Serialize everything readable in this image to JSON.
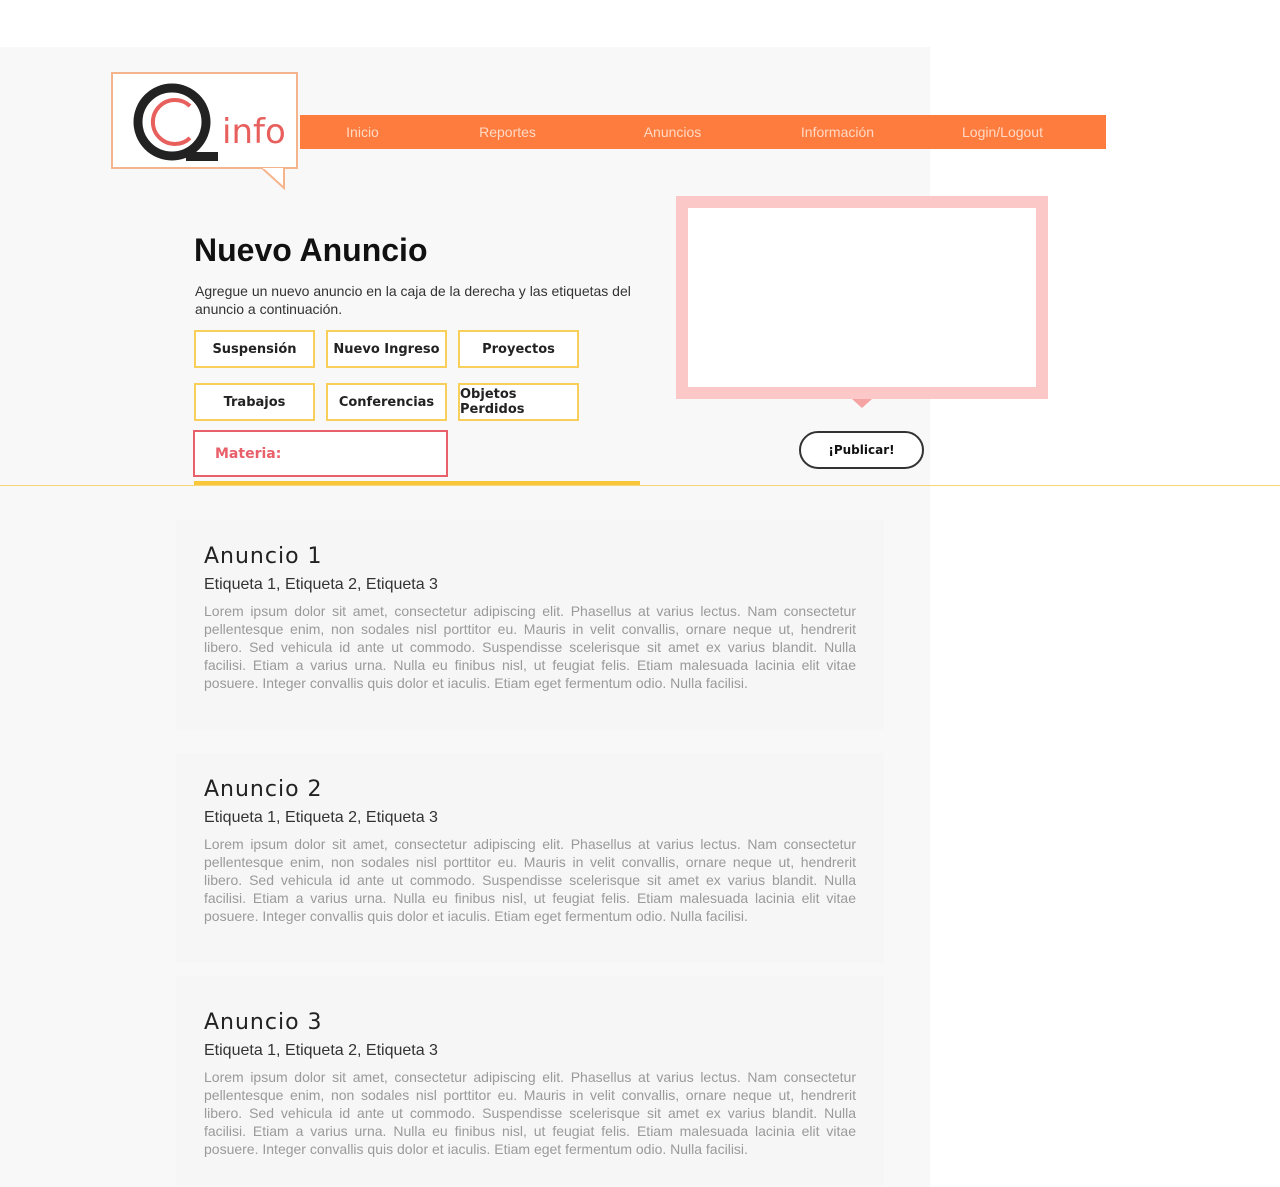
{
  "logo": {
    "letter": "Q",
    "text": "info"
  },
  "nav": {
    "items": [
      "Inicio",
      "Reportes",
      "Anuncios",
      "Información",
      "Login/Logout"
    ]
  },
  "header": {
    "title": "Nuevo Anuncio",
    "description": "Agregue un nuevo anuncio en la caja de la derecha y las etiquetas del anuncio a continuación."
  },
  "tags": [
    "Suspensión",
    "Nuevo Ingreso",
    "Proyectos",
    "Trabajos",
    "Conferencias",
    "Objetos Perdidos"
  ],
  "materia": {
    "label": "Materia:"
  },
  "publish": {
    "label": "¡Publicar!"
  },
  "announcements": [
    {
      "title": "Anuncio 1",
      "tags": "Etiqueta 1, Etiqueta 2, Etiqueta 3",
      "body": "Lorem ipsum dolor sit amet, consectetur adipiscing elit. Phasellus at varius lectus. Nam consectetur pellentesque enim, non sodales nisl porttitor eu. Mauris in velit convallis, ornare neque ut, hendrerit libero. Sed vehicula id ante ut commodo. Suspendisse scelerisque sit amet ex varius blandit. Nulla facilisi. Etiam a varius urna. Nulla eu finibus nisl, ut feugiat felis. Etiam malesuada lacinia elit vitae posuere. Integer convallis quis dolor et iaculis. Etiam eget fermentum odio. Nulla facilisi."
    },
    {
      "title": "Anuncio 2",
      "tags": "Etiqueta 1, Etiqueta 2, Etiqueta 3",
      "body": "Lorem ipsum dolor sit amet, consectetur adipiscing elit. Phasellus at varius lectus. Nam consectetur pellentesque enim, non sodales nisl porttitor eu. Mauris in velit convallis, ornare neque ut, hendrerit libero. Sed vehicula id ante ut commodo. Suspendisse scelerisque sit amet ex varius blandit. Nulla facilisi. Etiam a varius urna. Nulla eu finibus nisl, ut feugiat felis. Etiam malesuada lacinia elit vitae posuere. Integer convallis quis dolor et iaculis. Etiam eget fermentum odio. Nulla facilisi."
    },
    {
      "title": "Anuncio 3",
      "tags": "Etiqueta 1, Etiqueta 2, Etiqueta 3",
      "body": "Lorem ipsum dolor sit amet, consectetur adipiscing elit. Phasellus at varius lectus. Nam consectetur pellentesque enim, non sodales nisl porttitor eu. Mauris in velit convallis, ornare neque ut, hendrerit libero. Sed vehicula id ante ut commodo. Suspendisse scelerisque sit amet ex varius blandit. Nulla facilisi. Etiam a varius urna. Nulla eu finibus nisl, ut feugiat felis. Etiam malesuada lacinia elit vitae posuere. Integer convallis quis dolor et iaculis. Etiam eget fermentum odio. Nulla facilisi."
    }
  ],
  "colors": {
    "nav_bg": "#ff7c3f",
    "tag_border": "#f9cf5b",
    "materia_border": "#e8606a",
    "ad_border": "#fcc7c7",
    "logo_accent": "#e8605e"
  },
  "icons": {
    "logo": "speech-bubble-logo",
    "ad_pointer": "triangle-down-icon"
  }
}
